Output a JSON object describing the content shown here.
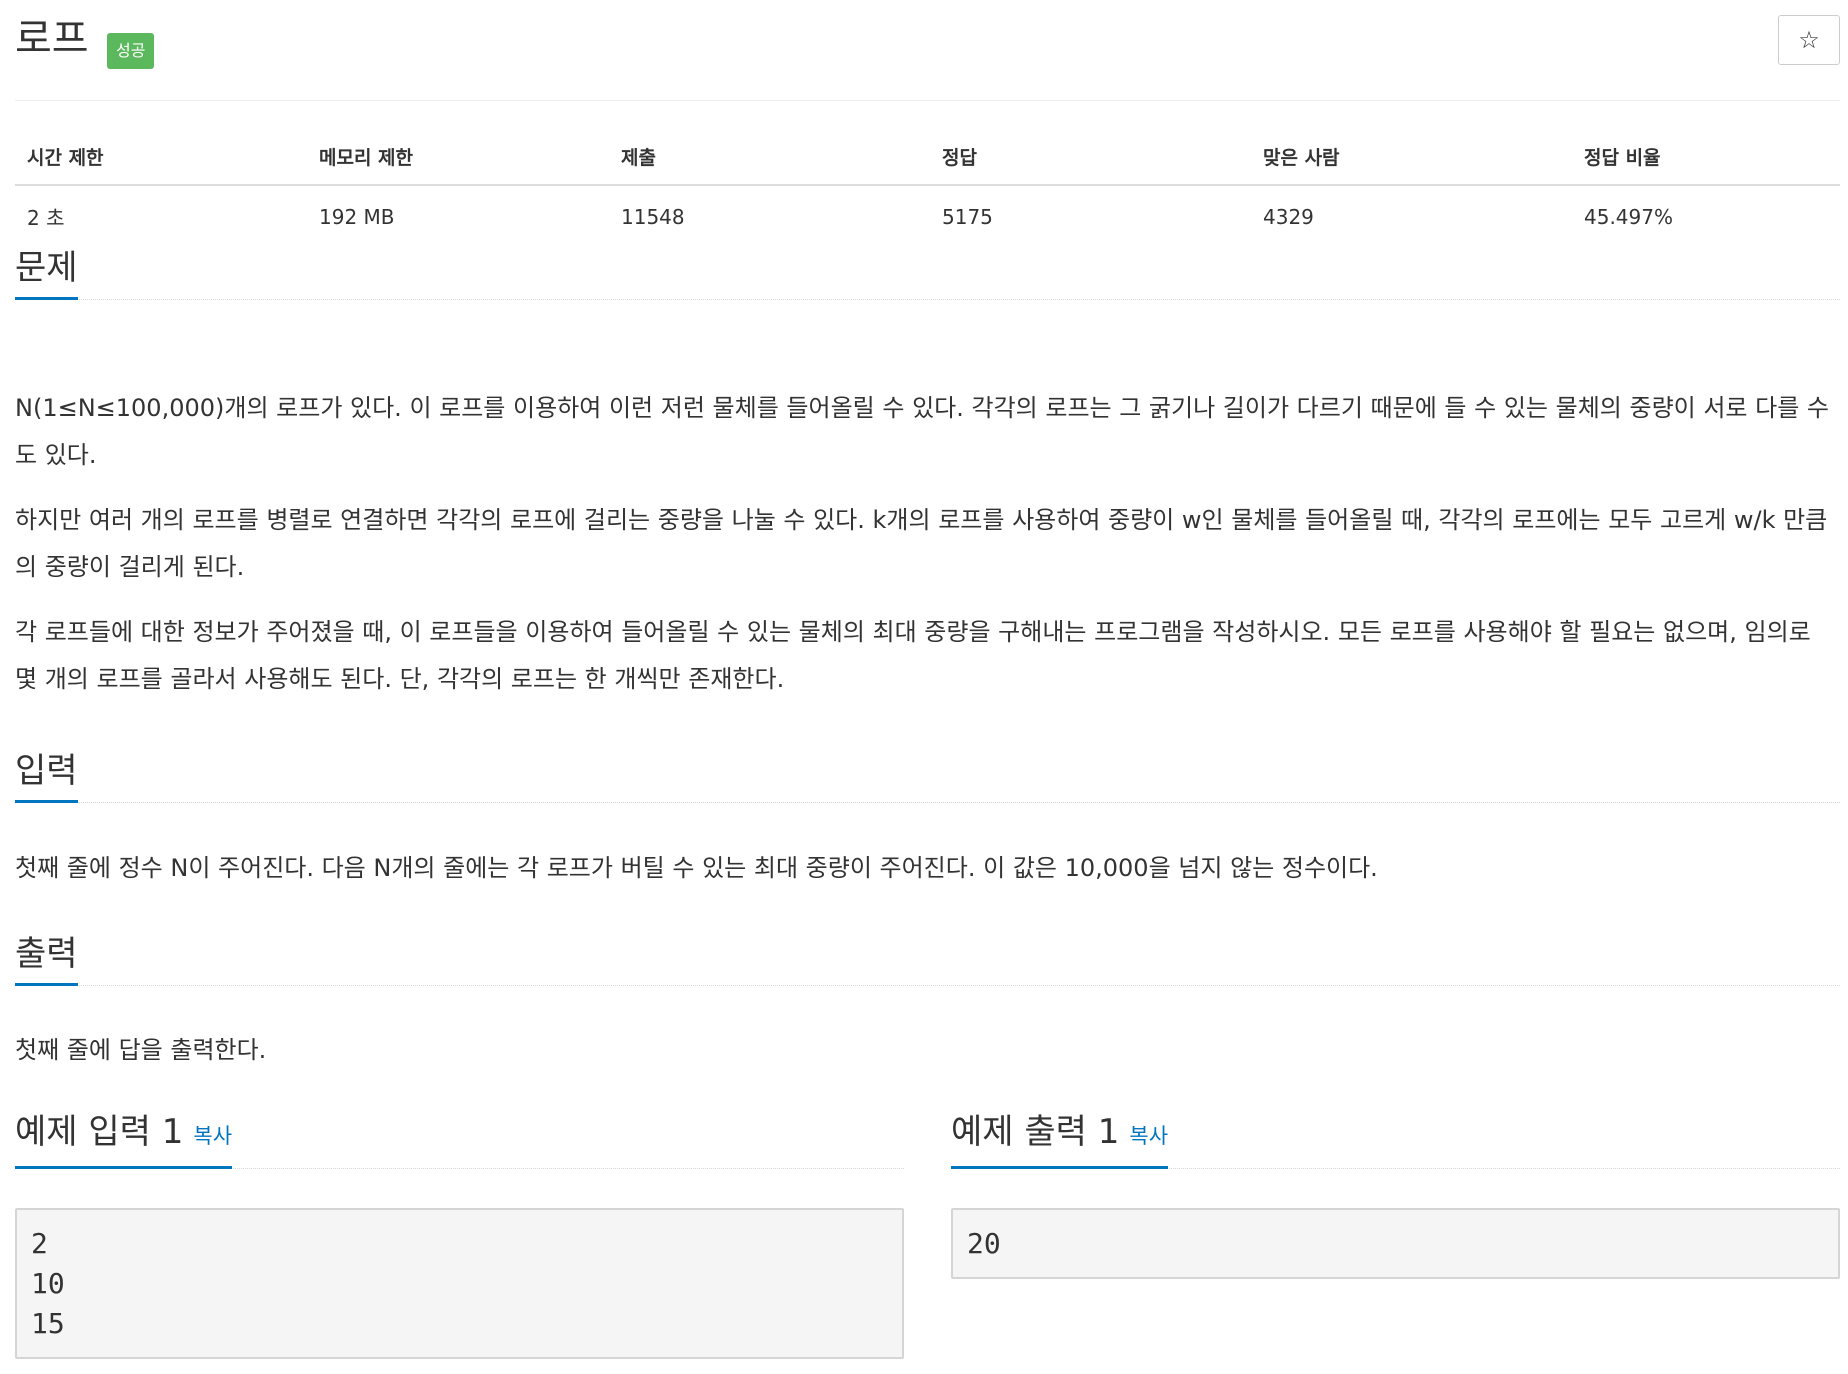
{
  "problem": {
    "title": "로프",
    "status_badge": "성공",
    "favorite_icon": "star-icon"
  },
  "stats": {
    "headers": [
      "시간 제한",
      "메모리 제한",
      "제출",
      "정답",
      "맞은 사람",
      "정답 비율"
    ],
    "values": [
      "2 초",
      "192 MB",
      "11548",
      "5175",
      "4329",
      "45.497%"
    ]
  },
  "sections": {
    "description": {
      "title": "문제",
      "paragraphs": [
        "N(1≤N≤100,000)개의 로프가 있다. 이 로프를 이용하여 이런 저런 물체를 들어올릴 수 있다. 각각의 로프는 그 굵기나 길이가 다르기 때문에 들 수 있는 물체의 중량이 서로 다를 수도 있다.",
        "하지만 여러 개의 로프를 병렬로 연결하면 각각의 로프에 걸리는 중량을 나눌 수 있다. k개의 로프를 사용하여 중량이 w인 물체를 들어올릴 때, 각각의 로프에는 모두 고르게 w/k 만큼의 중량이 걸리게 된다.",
        "각 로프들에 대한 정보가 주어졌을 때, 이 로프들을 이용하여 들어올릴 수 있는 물체의 최대 중량을 구해내는 프로그램을 작성하시오. 모든 로프를 사용해야 할 필요는 없으며, 임의로 몇 개의 로프를 골라서 사용해도 된다. 단, 각각의 로프는 한 개씩만 존재한다."
      ]
    },
    "input": {
      "title": "입력",
      "text": "첫째 줄에 정수 N이 주어진다. 다음 N개의 줄에는 각 로프가 버틸 수 있는 최대 중량이 주어진다. 이 값은 10,000을 넘지 않는 정수이다."
    },
    "output": {
      "title": "출력",
      "text": "첫째 줄에 답을 출력한다."
    }
  },
  "samples": {
    "input": {
      "title": "예제 입력 1",
      "copy_label": "복사",
      "content": "2\n10\n15"
    },
    "output": {
      "title": "예제 출력 1",
      "copy_label": "복사",
      "content": "20"
    }
  },
  "colors": {
    "accent": "#0076c0",
    "success": "#5cb85c"
  }
}
